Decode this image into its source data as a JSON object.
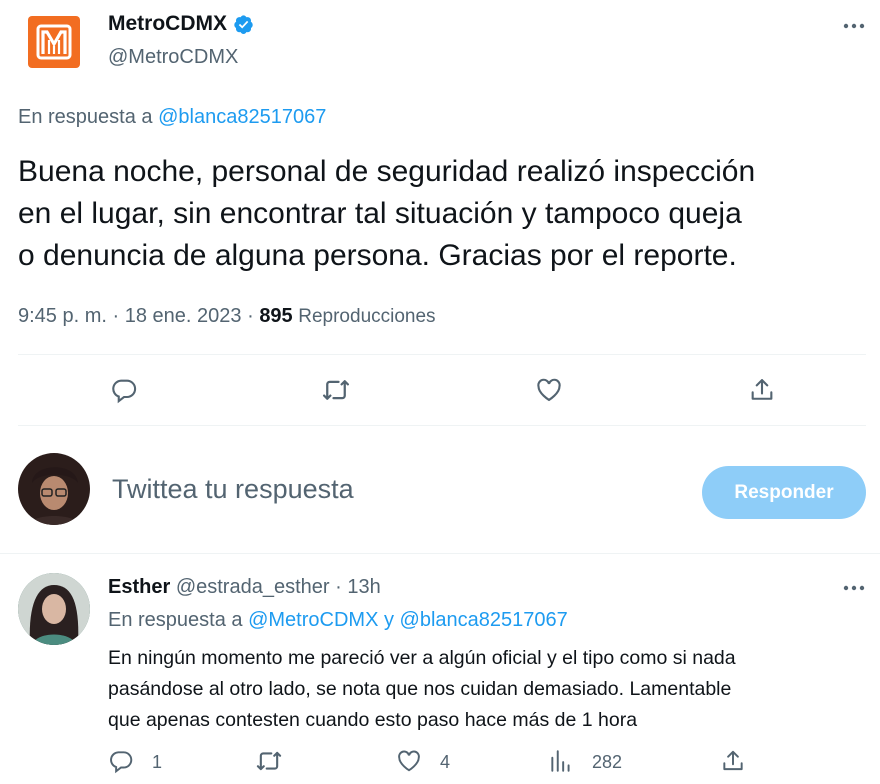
{
  "tweet": {
    "author_name": "MetroCDMX",
    "author_handle": "@MetroCDMX",
    "logo_text": "M",
    "reply_prefix": "En respuesta a",
    "reply_to": "@blanca82517067",
    "body_lines": [
      "Buena noche, personal de seguridad realizó inspección",
      "en el lugar, sin encontrar tal situación y tampoco queja",
      "o denuncia de alguna persona. Gracias por el reporte."
    ],
    "time": "9:45 p. m.",
    "sep": "·",
    "date": "18 ene. 2023",
    "views_count": "895",
    "views_label": "Reproducciones"
  },
  "composer": {
    "placeholder": "Twittea tu respuesta",
    "reply_button": "Responder"
  },
  "reply": {
    "name": "Esther",
    "handle": "@estrada_esther",
    "sep": "·",
    "time": "13h",
    "reply_prefix": "En respuesta a",
    "mention_1": "@MetroCDMX",
    "conjunction": "y",
    "mention_2": "@blanca82517067",
    "body_lines": [
      "En ningún momento me pareció ver a algún oficial y el tipo como si nada",
      "pasándose al otro lado, se nota que nos cuidan demasiado. Lamentable",
      "que apenas contesten cuando esto paso hace más de 1 hora"
    ],
    "reply_count": "1",
    "retweet_count": "",
    "like_count": "4",
    "views_count": "282"
  },
  "colors": {
    "accent": "#1d9bf0",
    "metro_orange": "#f26d21",
    "muted": "#536471",
    "button_disabled": "#8ecdf8"
  },
  "icons": [
    "verified-badge-icon",
    "more-icon",
    "reply-icon",
    "retweet-icon",
    "like-icon",
    "share-icon",
    "views-icon"
  ]
}
